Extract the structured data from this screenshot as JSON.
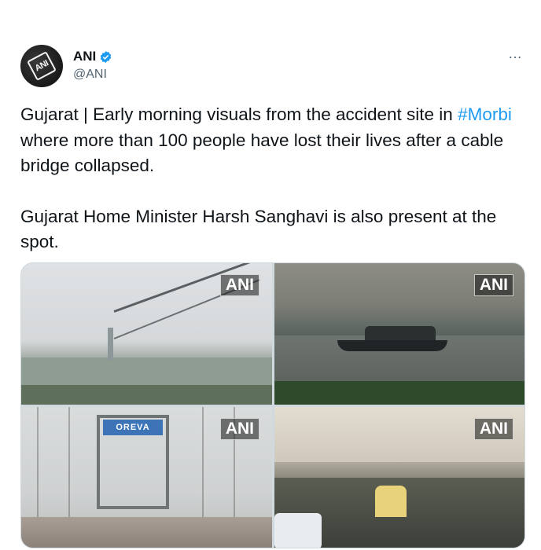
{
  "tweet": {
    "avatar_text": "ANI",
    "display_name": "ANI",
    "handle": "@ANI",
    "more_icon": "…",
    "text": {
      "para1_prefix": "Gujarat | Early morning visuals from the accident site in ",
      "hashtag": "#Morbi",
      "para1_suffix": " where more than 100 people have lost their lives after a cable bridge collapsed.",
      "para2": "Gujarat Home Minister Harsh Sanghavi is also present at the spot."
    },
    "media": {
      "watermarks": [
        "ANI",
        "ANI",
        "ANI",
        "ANI"
      ],
      "sign_text": "OREVA"
    }
  },
  "colors": {
    "text": "#0f1419",
    "secondary": "#536471",
    "link": "#1d9bf0",
    "verified": "#1d9bf0",
    "border": "#cfd9de"
  }
}
